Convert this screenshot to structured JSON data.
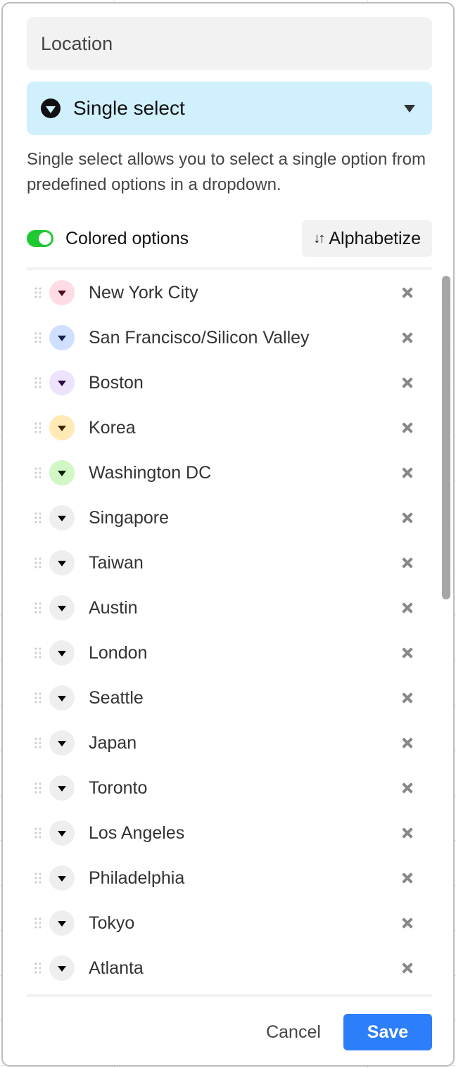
{
  "field": {
    "name_value": "Location",
    "type_label": "Single select",
    "type_icon": "dropdown-circle-icon",
    "description": "Single select allows you to select a single option from predefined options in a dropdown."
  },
  "controls": {
    "colored_options_label": "Colored options",
    "colored_options_on": true,
    "toggle_color": "#20c933",
    "alphabetize_label": "Alphabetize",
    "alphabetize_icon": "sort-arrows-icon"
  },
  "options": [
    {
      "label": "New York City",
      "bg": "#ffdce5",
      "tri": "#4c0c1c"
    },
    {
      "label": "San Francisco/Silicon Valley",
      "bg": "#cfdfff",
      "tri": "#102046"
    },
    {
      "label": "Boston",
      "bg": "#ede3fe",
      "tri": "#280b42"
    },
    {
      "label": "Korea",
      "bg": "#ffeab6",
      "tri": "#3b2501"
    },
    {
      "label": "Washington DC",
      "bg": "#d1f7c4",
      "tri": "#0b1d05"
    },
    {
      "label": "Singapore",
      "bg": "#eeeeee",
      "tri": "#000000"
    },
    {
      "label": "Taiwan",
      "bg": "#eeeeee",
      "tri": "#000000"
    },
    {
      "label": "Austin",
      "bg": "#eeeeee",
      "tri": "#000000"
    },
    {
      "label": "London",
      "bg": "#eeeeee",
      "tri": "#000000"
    },
    {
      "label": "Seattle",
      "bg": "#eeeeee",
      "tri": "#000000"
    },
    {
      "label": "Japan",
      "bg": "#eeeeee",
      "tri": "#000000"
    },
    {
      "label": "Toronto",
      "bg": "#eeeeee",
      "tri": "#000000"
    },
    {
      "label": "Los Angeles",
      "bg": "#eeeeee",
      "tri": "#000000"
    },
    {
      "label": "Philadelphia",
      "bg": "#eeeeee",
      "tri": "#000000"
    },
    {
      "label": "Tokyo",
      "bg": "#eeeeee",
      "tri": "#000000"
    },
    {
      "label": "Atlanta",
      "bg": "#eeeeee",
      "tri": "#000000"
    }
  ],
  "footer": {
    "cancel_label": "Cancel",
    "save_label": "Save",
    "save_color": "#2d7ff9"
  }
}
